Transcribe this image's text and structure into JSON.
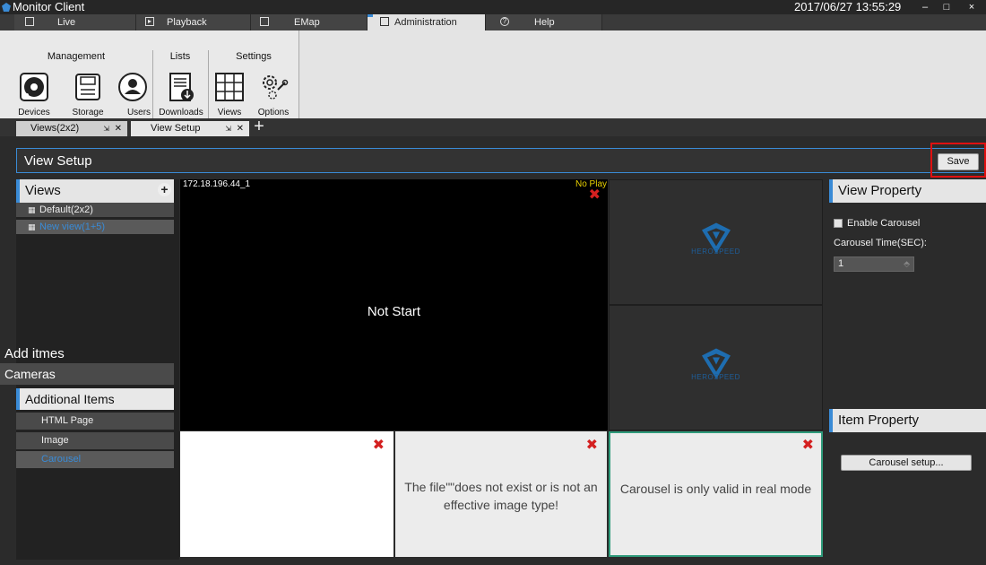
{
  "window": {
    "title": "Monitor Client",
    "datetime": "2017/06/27 13:55:29",
    "min": "–",
    "max": "□",
    "close": "×"
  },
  "main_tabs": [
    {
      "label": "Live",
      "icon": "monitor-icon"
    },
    {
      "label": "Playback",
      "icon": "play-icon"
    },
    {
      "label": "EMap",
      "icon": "map-icon"
    },
    {
      "label": "Administration",
      "icon": "folder-icon",
      "active": true
    },
    {
      "label": "Help",
      "icon": "help-icon"
    }
  ],
  "ribbon": {
    "groups": {
      "management": "Management",
      "lists": "Lists",
      "settings": "Settings"
    },
    "buttons": {
      "devices": "Devices",
      "storage": "Storage",
      "users": "Users",
      "downloads": "Downloads",
      "views": "Views",
      "options": "Options"
    }
  },
  "doc_tabs": [
    {
      "label": "Views(2x2)"
    },
    {
      "label": "View Setup",
      "active": true
    }
  ],
  "header": {
    "title": "View Setup",
    "save": "Save"
  },
  "views_panel": {
    "title": "Views",
    "items": [
      {
        "label": "Default(2x2)"
      },
      {
        "label": "New view(1+5)",
        "selected": true
      }
    ]
  },
  "add_items": {
    "title": "Add itmes",
    "categories": {
      "cameras": "Cameras",
      "additional": "Additional Items"
    },
    "items": [
      {
        "label": "HTML Page"
      },
      {
        "label": "Image"
      },
      {
        "label": "Carousel",
        "selected": true
      }
    ]
  },
  "grid": {
    "camera_label": "172.18.196.44_1",
    "no_play": "No Play",
    "not_start": "Not Start",
    "brand": "HEROSPEED",
    "image_error": "The file\"\"does not exist or is not an effective image type!",
    "carousel_msg": "Carousel is only valid in real mode"
  },
  "view_property": {
    "title": "View Property",
    "enable_carousel": "Enable Carousel",
    "carousel_time_label": "Carousel Time(SEC):",
    "carousel_time_value": "1"
  },
  "item_property": {
    "title": "Item Property",
    "carousel_setup": "Carousel setup..."
  },
  "colors": {
    "accent": "#3a8bd6",
    "highlight": "#e01010",
    "cell_border_active": "#2e9a7a"
  }
}
